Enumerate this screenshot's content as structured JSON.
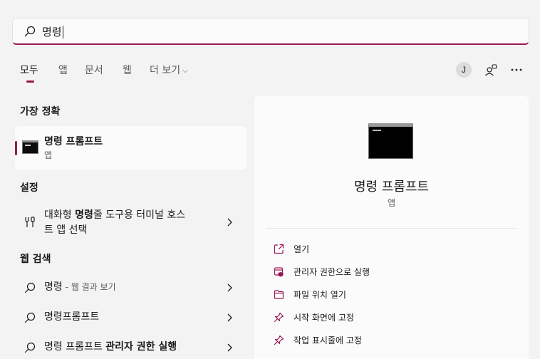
{
  "search": {
    "query": "명령",
    "icon": "search-icon"
  },
  "tabs": [
    {
      "label": "모두",
      "active": true
    },
    {
      "label": "앱"
    },
    {
      "label": "문서"
    },
    {
      "label": "웹"
    },
    {
      "label": "더 보기"
    }
  ],
  "header": {
    "avatar_initial": "J"
  },
  "best_match": {
    "section": "가장 정확",
    "title": "명령 프롬프트",
    "subtitle": "앱"
  },
  "settings": {
    "section": "설정",
    "item": {
      "pre": "대화형 ",
      "bold": "명령",
      "post": "줄 도구용 터미널 호스",
      "line2": "트 앱 선택"
    }
  },
  "web_search": {
    "section": "웹 검색",
    "items": [
      {
        "label": "명령",
        "suffix": " - 웹 결과 보기"
      },
      {
        "label": "명령프롬프트",
        "suffix": ""
      },
      {
        "label": "명령 프롬프트 ",
        "bold": "관리자 권한 실행"
      }
    ]
  },
  "detail": {
    "title": "명령 프롬프트",
    "subtitle": "앱",
    "actions": [
      {
        "label": "열기",
        "icon": "open-external-icon"
      },
      {
        "label": "관리자 권한으로 실행",
        "icon": "shield-admin-icon"
      },
      {
        "label": "파일 위치 열기",
        "icon": "folder-icon"
      },
      {
        "label": "시작 화면에 고정",
        "icon": "pin-icon"
      },
      {
        "label": "작업 표시줄에 고정",
        "icon": "pin-icon"
      }
    ]
  },
  "colors": {
    "accent": "#9a1750",
    "background": "#f3f3f3",
    "card": "#fbfbfb"
  }
}
